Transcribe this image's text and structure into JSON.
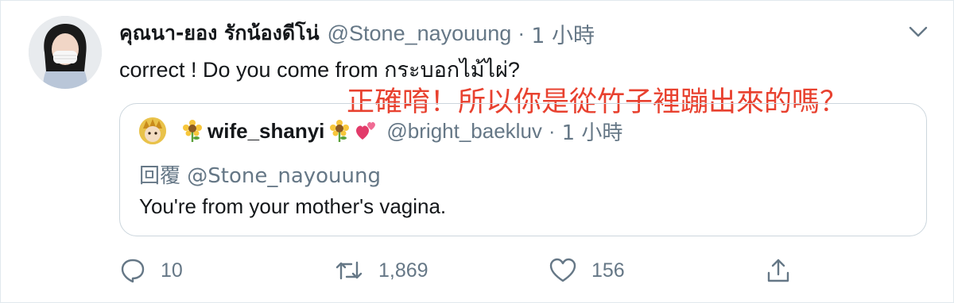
{
  "tweet": {
    "display_name": "คุณนา-ยอง รักน้องดีโน่",
    "handle": "@Stone_nayouung",
    "separator": "·",
    "time": "1 小時",
    "text": "correct ! Do you come from กระบอกไม้ไผ่?",
    "overlay_translation": "正確唷！所以你是從竹子裡蹦出來的嗎？"
  },
  "quoted": {
    "display_name": "wife_shanyi",
    "handle": "@bright_baekluv",
    "separator": "·",
    "time": "1 小時",
    "reply_to": "回覆 @Stone_nayouung",
    "text": "You're from your mother's vagina."
  },
  "actions": {
    "reply_count": "10",
    "retweet_count": "1,869",
    "like_count": "156"
  },
  "colors": {
    "secondary_text": "#657786",
    "overlay_red": "#e8412f",
    "border": "#ccd6dd"
  },
  "icons": [
    "caret-down-icon",
    "sunflower-emoji-icon",
    "hearts-emoji-icon",
    "reply-icon",
    "retweet-icon",
    "like-icon",
    "share-icon"
  ]
}
